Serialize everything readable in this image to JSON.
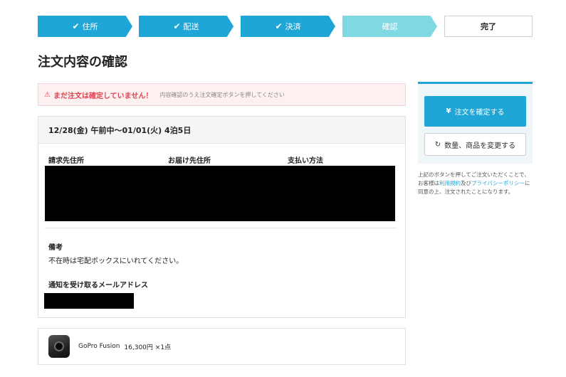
{
  "stepper": {
    "steps": [
      {
        "label": "住所",
        "state": "done"
      },
      {
        "label": "配送",
        "state": "done"
      },
      {
        "label": "決済",
        "state": "done"
      },
      {
        "label": "確認",
        "state": "current"
      },
      {
        "label": "完了",
        "state": "pending"
      }
    ],
    "check_glyph": "✔"
  },
  "page": {
    "title": "注文内容の確認"
  },
  "alert": {
    "icon": "⚠",
    "main": "まだ注文は確定していません！",
    "sub": "内容確認のうえ注文確定ボタンを押してください"
  },
  "order": {
    "period": "12/28(金) 午前中〜01/01(火) 4泊5日",
    "columns": [
      "請求先住所",
      "お届け先住所",
      "支払い方法"
    ],
    "note_label": "備考",
    "note_text": "不在時は宅配ボックスにいれてください。",
    "email_label": "通知を受け取るメールアドレス"
  },
  "item": {
    "name": "GoPro Fusion",
    "price_qty": "16,300円 ×1点"
  },
  "side": {
    "confirm_icon": "¥",
    "confirm_label": "注文を確定する",
    "change_icon": "↻",
    "change_label": "数量、商品を変更する",
    "note_pre": "上記のボタンを押してご注文いただくことで、お客様は",
    "terms_link": "利用規約",
    "note_and": "及び",
    "privacy_link": "プライバシーポリシー",
    "note_post": "に同意の上、注文されたことになります。"
  },
  "colors": {
    "accent": "#1fa5d6",
    "step_current": "#7fd8e2",
    "alert_red": "#e3414e"
  }
}
